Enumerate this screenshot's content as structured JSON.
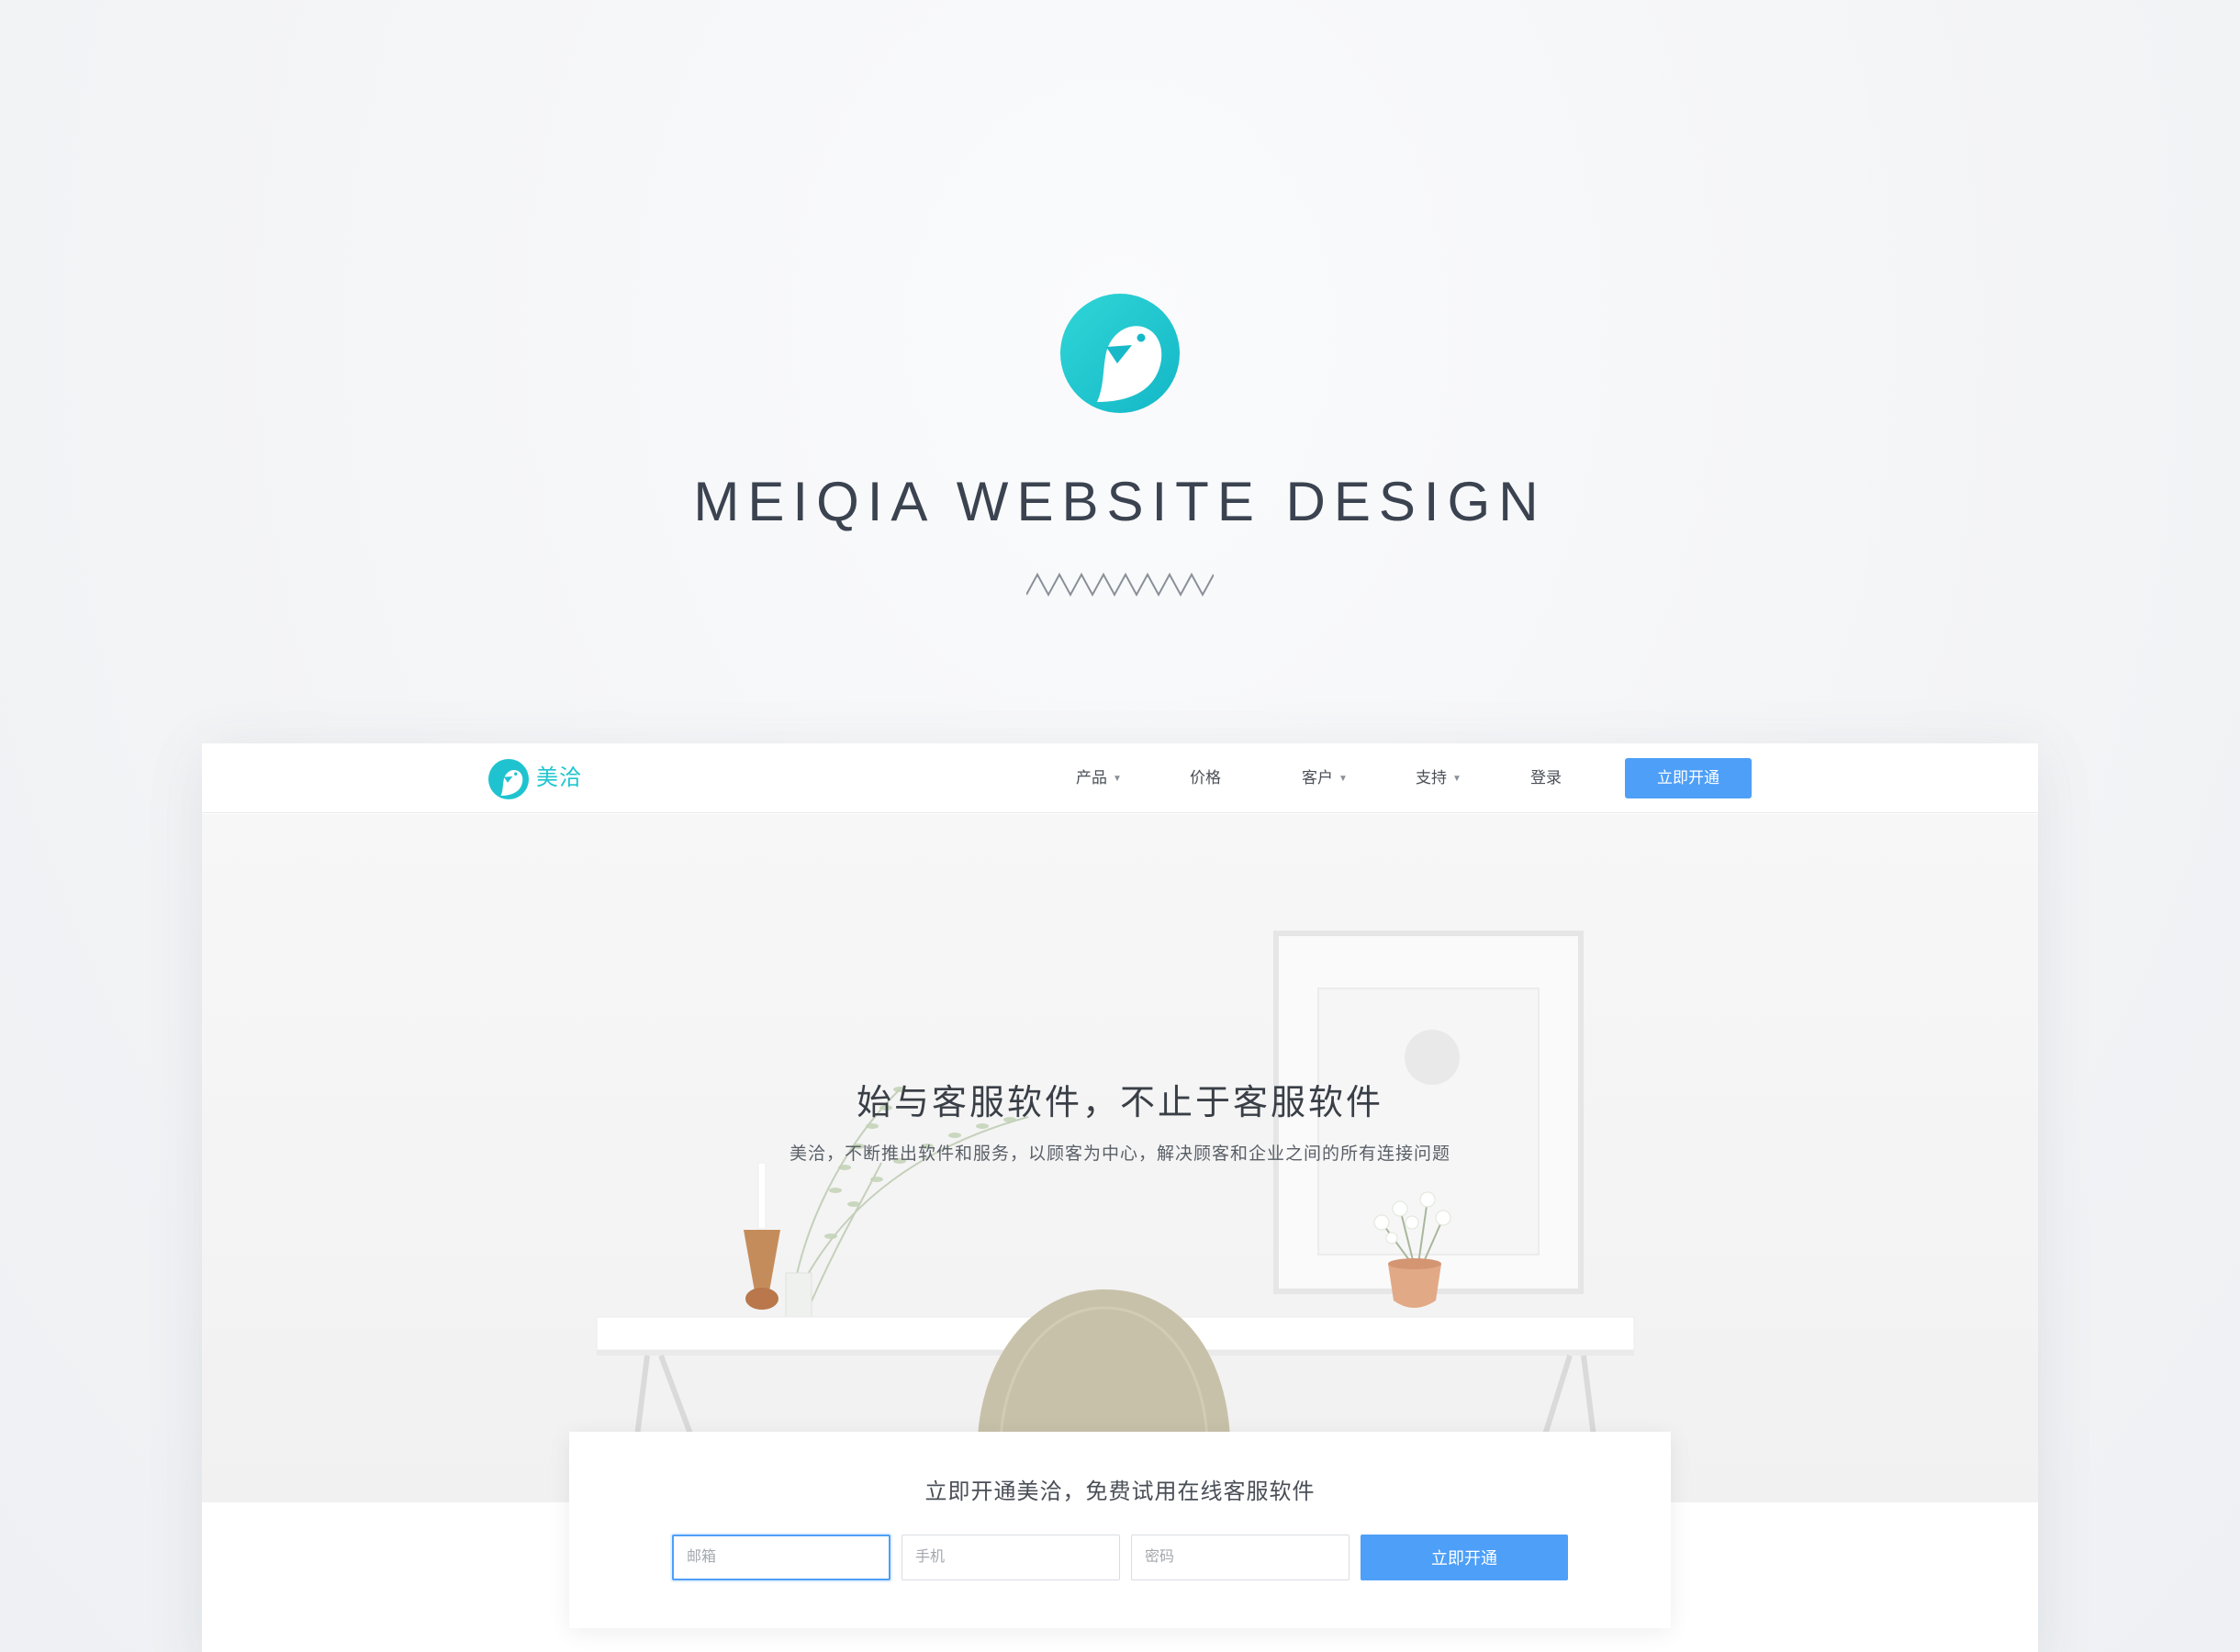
{
  "presentation": {
    "title": "MEIQIA WEBSITE DESIGN",
    "logo_icon": "meiqia-bird-logo-icon",
    "divider_icon": "zigzag-divider-icon"
  },
  "colors": {
    "brand_teal": "#20c5cf",
    "primary_blue": "#4e9ff7",
    "text_dark": "#3a3f47"
  },
  "nav": {
    "brand": "美洽",
    "items": [
      {
        "label": "产品",
        "dropdown": true
      },
      {
        "label": "价格",
        "dropdown": false
      },
      {
        "label": "客户",
        "dropdown": true
      },
      {
        "label": "支持",
        "dropdown": true
      },
      {
        "label": "登录",
        "dropdown": false
      }
    ],
    "cta": "立即开通"
  },
  "banner": {
    "title": "始与客服软件，不止于客服软件",
    "subtitle": "美洽，不断推出软件和服务，以顾客为中心，解决顾客和企业之间的所有连接问题"
  },
  "signup": {
    "title": "立即开通美洽，免费试用在线客服软件",
    "email_placeholder": "邮箱",
    "phone_placeholder": "手机",
    "password_placeholder": "密码",
    "submit": "立即开通"
  }
}
